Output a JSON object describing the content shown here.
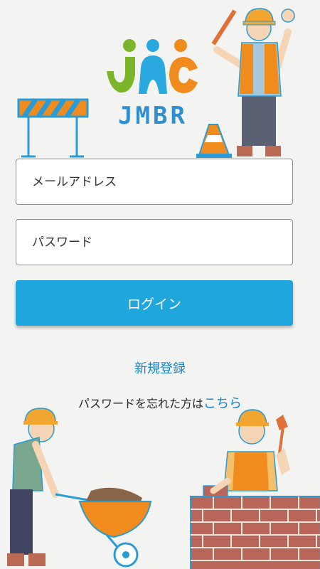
{
  "app": {
    "logo_text": "JMBR",
    "colors": {
      "accent": "#1fa6dd",
      "link": "#1d86c6",
      "logo_green": "#7bb52a",
      "logo_blue": "#2aa8e0",
      "logo_orange": "#f08c1e"
    }
  },
  "form": {
    "email_placeholder": "メールアドレス",
    "password_placeholder": "パスワード",
    "login_label": "ログイン"
  },
  "links": {
    "register_label": "新規登録",
    "forgot_prefix": "パスワードを忘れた方は",
    "forgot_link_label": "こちら"
  }
}
